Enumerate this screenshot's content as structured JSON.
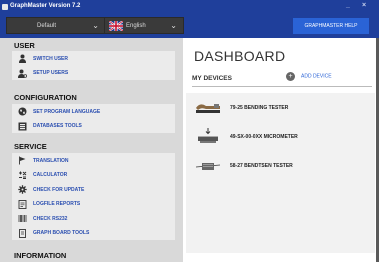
{
  "window": {
    "title": "GraphMaster Version 7.2",
    "controls": [
      "_",
      "×"
    ]
  },
  "toolbar": {
    "profile_value": "Default",
    "language_value": "English",
    "help_label": "GRAPHMASTER HELP"
  },
  "sidebar": {
    "sections": [
      {
        "title": "USER",
        "items": [
          {
            "label": "SWITCH USER",
            "icon": "user-icon"
          },
          {
            "label": "SETUP USERS",
            "icon": "user-settings-icon"
          }
        ]
      },
      {
        "title": "CONFIGURATION",
        "items": [
          {
            "label": "SET PROGRAM LANGUAGE",
            "icon": "globe-icon"
          },
          {
            "label": "DATABASES TOOLS",
            "icon": "database-icon"
          }
        ]
      },
      {
        "title": "SERVICE",
        "items": [
          {
            "label": "TRANSLATION",
            "icon": "flag-icon"
          },
          {
            "label": "CALCULATOR",
            "icon": "calculator-icon"
          },
          {
            "label": "CHECK FOR UPDATE",
            "icon": "gear-icon"
          },
          {
            "label": "LOGFILE REPORTS",
            "icon": "log-icon"
          },
          {
            "label": "CHECK RS232",
            "icon": "barcode-icon"
          },
          {
            "label": "GRAPH BOARD TOOLS",
            "icon": "board-icon"
          }
        ]
      },
      {
        "title": "INFORMATION",
        "items": []
      }
    ]
  },
  "main": {
    "title": "DASHBOARD",
    "devices_heading": "MY DEVICES",
    "add_device_label": "ADD DEVICE",
    "devices": [
      {
        "name": "79-25 BENDING TESTER",
        "icon": "bending-tester-icon"
      },
      {
        "name": "49-SX-00-0XX MICROMETER",
        "icon": "micrometer-icon"
      },
      {
        "name": "58-27 BENDTSEN TESTER",
        "icon": "bendtsen-tester-icon"
      }
    ]
  },
  "colors": {
    "titlebar": "#1f3f9b",
    "accent": "#2a63d6",
    "link": "#2a4eb0",
    "sidebar_bg": "#d9d9d9",
    "group_bg": "#ebebeb"
  }
}
